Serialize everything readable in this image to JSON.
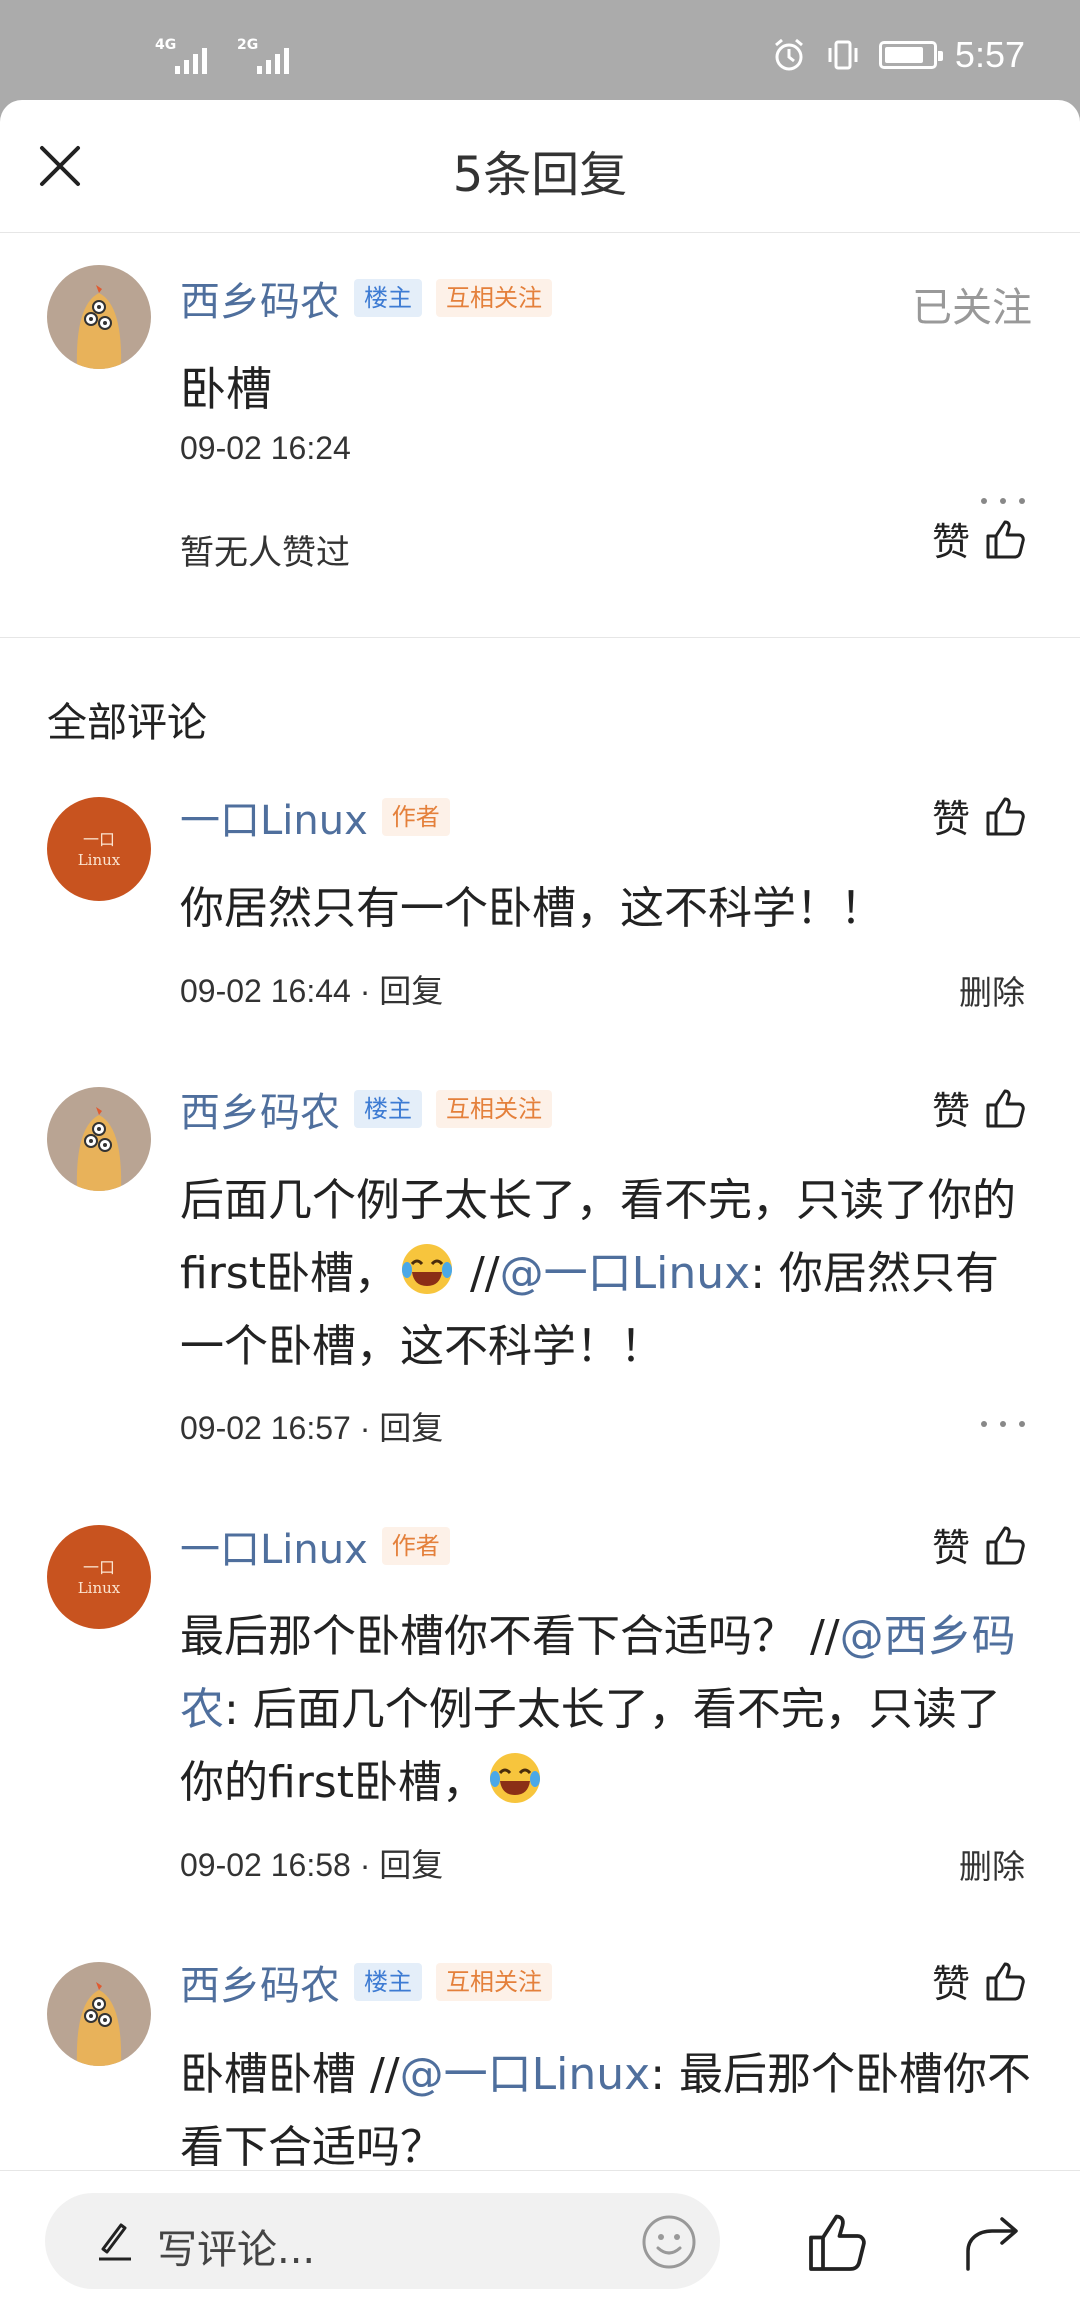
{
  "status_bar": {
    "network1": "4G",
    "network2": "2G",
    "time": "5:57"
  },
  "header": {
    "title": "5条回复"
  },
  "post": {
    "username": "西乡码农",
    "badge_owner": "楼主",
    "badge_mutual": "互相关注",
    "follow_status": "已关注",
    "text": "卧槽",
    "time": "09-02 16:24",
    "no_likes": "暂无人赞过",
    "like_label": "赞"
  },
  "section_title": "全部评论",
  "comments": [
    {
      "username": "一口Linux",
      "badge": "作者",
      "like_label": "赞",
      "text": "你居然只有一个卧槽，这不科学！！",
      "time": "09-02 16:44",
      "reply_label": "回复",
      "action": "删除"
    },
    {
      "username": "西乡码农",
      "badge_owner": "楼主",
      "badge_mutual": "互相关注",
      "like_label": "赞",
      "text_a": "后面几个例子太长了，看不完，只读了你的first卧槽，",
      "text_b": " //",
      "mention": "@一口Linux",
      "text_c": ": 你居然只有一个卧槽，这不科学！！",
      "time": "09-02 16:57",
      "reply_label": "回复"
    },
    {
      "username": "一口Linux",
      "badge": "作者",
      "like_label": "赞",
      "text_a": "最后那个卧槽你不看下合适吗？ //",
      "mention": "@西乡码农",
      "text_b": ": 后面几个例子太长了，看不完，只读了你的first卧槽，",
      "time": "09-02 16:58",
      "reply_label": "回复",
      "action": "删除"
    },
    {
      "username": "西乡码农",
      "badge_owner": "楼主",
      "badge_mutual": "互相关注",
      "like_label": "赞",
      "text_a": "卧槽卧槽 //",
      "mention": "@一口Linux",
      "text_b": ": 最后那个卧槽你不看下合适吗？"
    }
  ],
  "bottom_bar": {
    "placeholder": "写评论..."
  },
  "avatar_linux_text_top": "一口",
  "avatar_linux_text_bottom": "Linux",
  "colors": {
    "link": "#4f6f9d",
    "author_avatar": "#c8531f",
    "badge_owner": "#3d7bd3",
    "badge_mutual": "#e4803b"
  },
  "icons": [
    "close-icon",
    "thumbs-up-icon",
    "more-dots-icon",
    "pen-icon",
    "smiley-icon",
    "share-icon",
    "laughing-emoji-icon"
  ]
}
